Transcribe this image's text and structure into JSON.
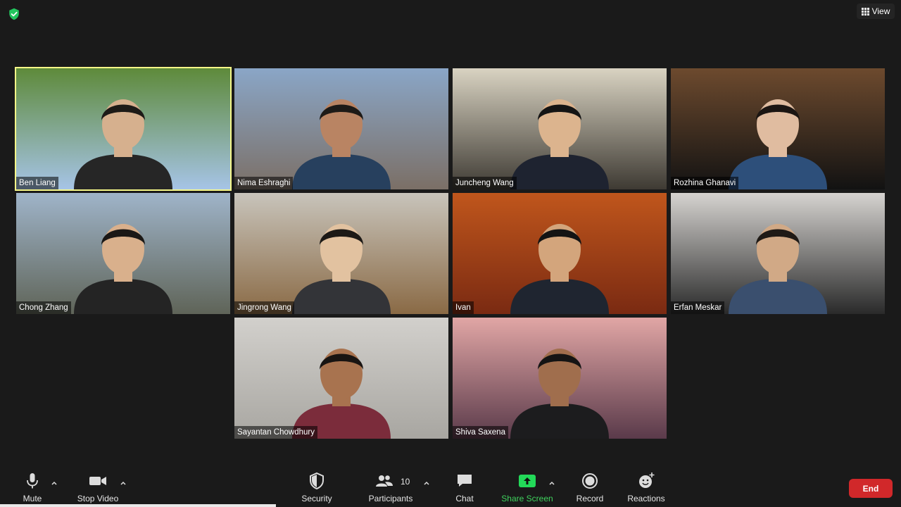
{
  "top": {
    "view_label": "View"
  },
  "participants": [
    {
      "name": "Ben Liang",
      "active": true,
      "bg": [
        "#5e8a3a",
        "#a6c4e6"
      ],
      "skin": "#d6b08e",
      "shirt": "#262626",
      "hair": "#1d1a17"
    },
    {
      "name": "Nima Eshraghi",
      "active": false,
      "bg": [
        "#8aa6c7",
        "#7b6f66"
      ],
      "skin": "#b98463",
      "shirt": "#27405e",
      "hair": "#1d1a17"
    },
    {
      "name": "Juncheng Wang",
      "active": false,
      "bg": [
        "#d9d3c2",
        "#3e3a33"
      ],
      "skin": "#dcb48e",
      "shirt": "#1e2330",
      "hair": "#141414"
    },
    {
      "name": "Rozhina Ghanavi",
      "active": false,
      "bg": [
        "#6d4a2e",
        "#121212"
      ],
      "skin": "#e0bca0",
      "shirt": "#2d4f7a",
      "hair": "#1b1512"
    },
    {
      "name": "Chong Zhang",
      "active": false,
      "bg": [
        "#9fb4c9",
        "#5f6458"
      ],
      "skin": "#d9b08c",
      "shirt": "#242424",
      "hair": "#1b1816"
    },
    {
      "name": "Jingrong Wang",
      "active": false,
      "bg": [
        "#c8c4bb",
        "#8a6a45"
      ],
      "skin": "#e2c2a0",
      "shirt": "#333438",
      "hair": "#1c1916"
    },
    {
      "name": "Ivan",
      "active": false,
      "bg": [
        "#c0561c",
        "#7a2a12"
      ],
      "skin": "#d3a57c",
      "shirt": "#1f2530",
      "hair": "#141414"
    },
    {
      "name": "Erfan Meskar",
      "active": false,
      "bg": [
        "#d6d3d0",
        "#2a2a2a"
      ],
      "skin": "#d1a986",
      "shirt": "#3a4f6e",
      "hair": "#1f1a16"
    },
    {
      "name": "Sayantan Chowdhury",
      "active": false,
      "bg": [
        "#d2d0cc",
        "#a8a6a1"
      ],
      "skin": "#a8734f",
      "shirt": "#7b2c3b",
      "hair": "#181412"
    },
    {
      "name": "Shiva Saxena",
      "active": false,
      "bg": [
        "#e1a6a5",
        "#5a3a4a"
      ],
      "skin": "#a06e4d",
      "shirt": "#1c1c1e",
      "hair": "#141414"
    }
  ],
  "toolbar": {
    "mute_label": "Mute",
    "stop_video_label": "Stop Video",
    "security_label": "Security",
    "participants_label": "Participants",
    "participants_count": "10",
    "chat_label": "Chat",
    "share_screen_label": "Share Screen",
    "record_label": "Record",
    "reactions_label": "Reactions",
    "end_label": "End"
  },
  "colors": {
    "share_green": "#23d959",
    "end_red": "#d1282a",
    "active_border": "#f6f788",
    "shield_green": "#22c55e"
  }
}
